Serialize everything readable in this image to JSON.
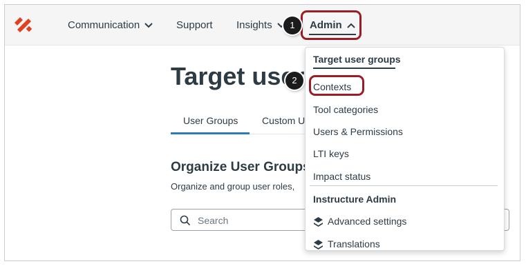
{
  "nav": {
    "communication": "Communication",
    "support": "Support",
    "insights": "Insights",
    "admin": "Admin"
  },
  "callouts": {
    "one": "1",
    "two": "2"
  },
  "page": {
    "title": "Target user",
    "tabs": [
      "User Groups",
      "Custom U"
    ],
    "section_heading": "Organize User Groups",
    "section_desc": "Organize and group user roles,",
    "search_placeholder": "Search"
  },
  "admin_menu": {
    "header": "Target user groups",
    "items": [
      "Contexts",
      "Tool categories",
      "Users & Permissions",
      "LTI keys",
      "Impact status"
    ],
    "section_header": "Instructure Admin",
    "sub_items": [
      "Advanced settings",
      "Translations"
    ]
  },
  "colors": {
    "brand": "#e0401e",
    "highlight": "#9b1c24",
    "tab_active": "#2b7abc",
    "text": "#2d3b45"
  },
  "icons": {
    "logo": "impact-logo-icon",
    "dropdown": "chevron-down-icon",
    "admin_open": "chevron-up-icon",
    "search": "search-icon",
    "instructure": "instructure-icon"
  }
}
